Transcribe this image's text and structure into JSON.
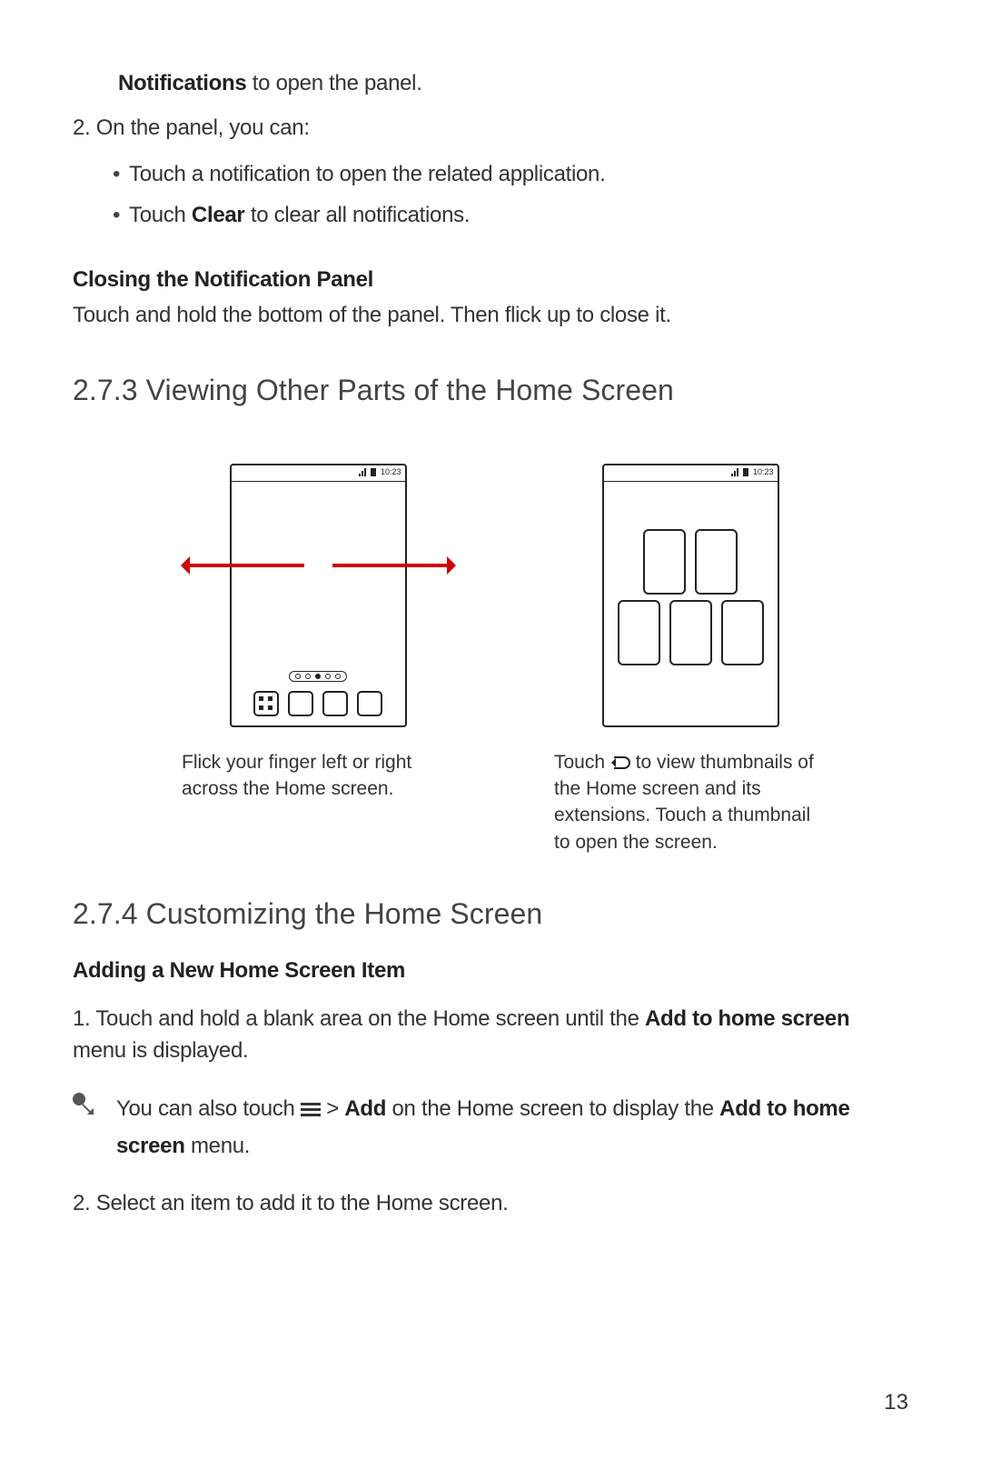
{
  "frag": {
    "bold": "Notifications",
    "rest": " to open the panel."
  },
  "step2_intro": "2. On the panel, you can:",
  "bullet1": "Touch a notification to open the related application.",
  "bullet2": {
    "pre": "Touch ",
    "bold": "Clear",
    "post": " to clear all notifications."
  },
  "closing_head": "Closing the Notification Panel",
  "closing_body": "Touch and hold the bottom of the panel. Then flick up to close it.",
  "sec273": "2.7.3  Viewing Other Parts of the Home Screen",
  "status_time": "10:23",
  "cap_left": "Flick your finger left or right across the Home screen.",
  "cap_right_a": "Touch ",
  "cap_right_b": " to view thumbnails of the Home screen and its extensions. Touch a thumbnail to open the screen.",
  "sec274": "2.7.4  Customizing the Home Screen",
  "adding_head": "Adding a New Home Screen Item",
  "add_step1_a": "1. Touch and hold a blank area on the Home screen until the ",
  "add_step1_bold": "Add to home screen",
  "add_step1_b": " menu is displayed.",
  "tip_a": "You can also touch  ",
  "tip_b": "  >  ",
  "tip_bold1": "Add",
  "tip_c": " on the Home screen to display the ",
  "tip_bold2": "Add to home screen",
  "tip_d": " menu.",
  "add_step2": "2. Select an item to add it to the Home screen.",
  "page_no": "13"
}
